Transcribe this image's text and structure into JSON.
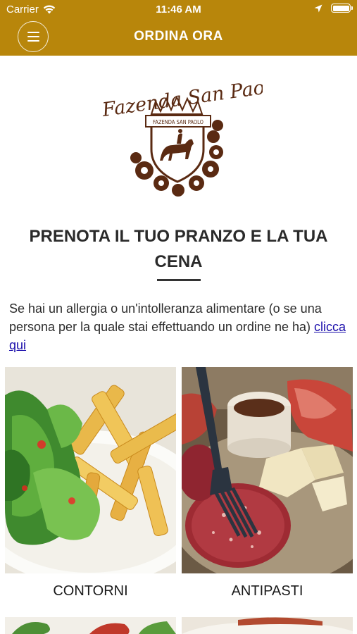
{
  "status_bar": {
    "carrier": "Carrier",
    "time": "11:46 AM"
  },
  "nav": {
    "title": "ORDINA ORA"
  },
  "logo": {
    "text": "Fazenda San Paolo",
    "banner_text": "FAZENDA SAN PAOLO"
  },
  "headline": "PRENOTA IL TUO PRANZO E LA TUA CENA",
  "allergy": {
    "text": "Se hai un allergia o un'intolleranza alimentare (o se una persona per la quale stai effettuando un ordine ne ha)",
    "link": "clicca qui"
  },
  "categories": [
    {
      "label": "CONTORNI"
    },
    {
      "label": "ANTIPASTI"
    }
  ],
  "colors": {
    "brand": "#b8860b",
    "logo": "#5a2a12",
    "link": "#1a0dab"
  }
}
